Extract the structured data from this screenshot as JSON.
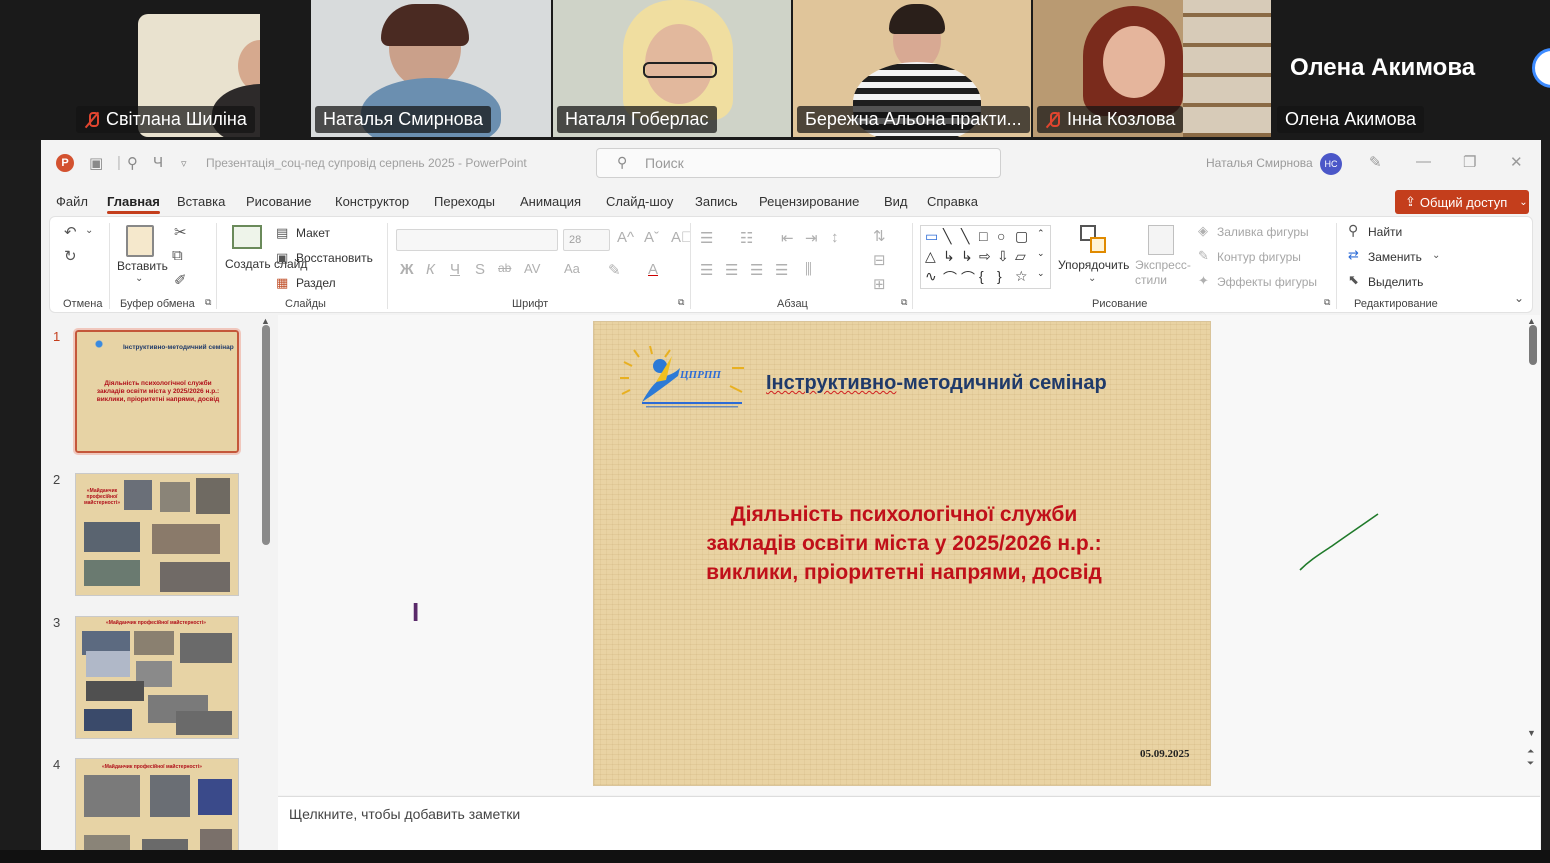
{
  "participants": [
    {
      "name": "Світлана Шиліна",
      "muted": true
    },
    {
      "name": "Наталья Смирнова",
      "muted": false,
      "active": true
    },
    {
      "name": "Наталя Гоберлас",
      "muted": false
    },
    {
      "name": "Бережна Альона практи...",
      "muted": false
    },
    {
      "name": "Інна Козлова",
      "muted": true
    },
    {
      "name": "Олена Акимова",
      "muted": false
    }
  ],
  "big_name": "Олена Акимова",
  "window": {
    "doc_title": "Презентація_соц-пед супровід серпень 2025  -  PowerPoint",
    "search_placeholder": "Поиск",
    "user_name": "Наталья Смирнова",
    "user_initials": "НС"
  },
  "menu": [
    "Файл",
    "Главная",
    "Вставка",
    "Рисование",
    "Конструктор",
    "Переходы",
    "Анимация",
    "Слайд-шоу",
    "Запись",
    "Рецензирование",
    "Вид",
    "Справка"
  ],
  "share_label": "Общий доступ",
  "ribbon": {
    "groups": {
      "undo": "Отмена",
      "clipboard": "Буфер обмена",
      "slides": "Слайды",
      "font": "Шрифт",
      "paragraph": "Абзац",
      "drawing": "Рисование",
      "editing": "Редактирование"
    },
    "paste": "Вставить",
    "new_slide": "Создать слайд",
    "layout": "Макет",
    "reset": "Восстановить",
    "section": "Раздел",
    "font_size": "28",
    "arrange": "Упорядочить",
    "quick_styles": "Экспресс-стили",
    "shape_fill": "Заливка фигуры",
    "shape_outline": "Контур фигуры",
    "shape_effects": "Эффекты фигуры",
    "find": "Найти",
    "replace": "Заменить",
    "select": "Выделить"
  },
  "thumbnails": [
    {
      "num": "1",
      "title": "Інструктивно-методичний семінар",
      "body": "Діяльність психологічної служби закладів освіти міста у 2025/2026 н.р.: виклики, пріоритетні напрями, досвід"
    },
    {
      "num": "2",
      "title": "«Майданчик професійної майстерності»"
    },
    {
      "num": "3",
      "title": "«Майданчик професійної майстерності»"
    },
    {
      "num": "4",
      "title": "«Майданчик професійної майстерності»"
    }
  ],
  "slide": {
    "logo_text": "ЦПРПП",
    "title_a": "Інструктивно",
    "title_b": "-методичний семінар",
    "line1": "Діяльність психологічної служби",
    "line2": "закладів освіти міста у 2025/2026 н.р.:",
    "line3": "виклики, пріоритетні напрями, досвід",
    "date": "05.09.2025"
  },
  "notes_placeholder": "Щелкните, чтобы добавить заметки",
  "colors": {
    "accent": "#c43e1c",
    "slide_title": "#1f3a6a",
    "slide_body": "#c0101a",
    "active_speaker": "#21d26a"
  }
}
